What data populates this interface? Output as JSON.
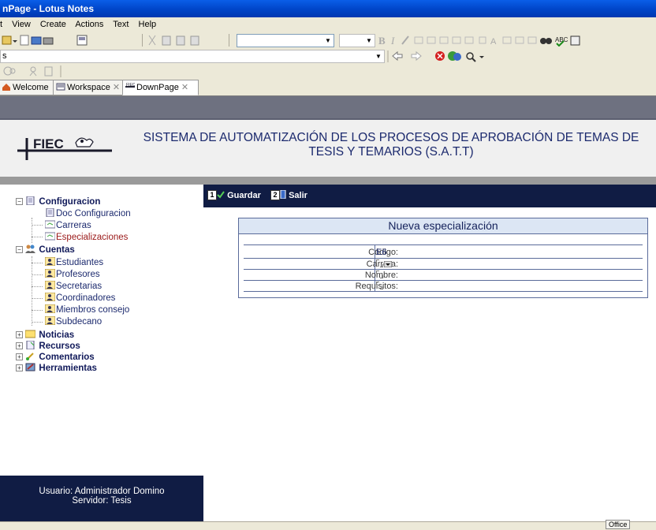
{
  "window": {
    "title": "nPage - Lotus Notes"
  },
  "menu": [
    "t",
    "View",
    "Create",
    "Actions",
    "Text",
    "Help"
  ],
  "toolbar": {
    "address_text": "s"
  },
  "tabs": [
    {
      "label": "Welcome",
      "icon": "home-icon"
    },
    {
      "label": "Workspace",
      "icon": "workspace-icon"
    },
    {
      "label": "DownPage",
      "icon": "fiec-icon"
    }
  ],
  "header": {
    "logo_text": "FIEC",
    "title_line1": "SISTEMA DE AUTOMATIZACIÓN DE LOS PROCESOS DE APROBACIÓN DE TEMAS DE",
    "title_line2": "TESIS Y TEMARIOS (S.A.T.T)"
  },
  "actions": {
    "guardar": {
      "num": "1",
      "label": "Guardar"
    },
    "salir": {
      "num": "2",
      "label": "Salir"
    }
  },
  "sidebar": {
    "configuracion": "Configuracion",
    "doc_configuracion": "Doc Configuracion",
    "carreras": "Carreras",
    "especializaciones": "Especializaciones",
    "cuentas": "Cuentas",
    "estudiantes": "Estudiantes",
    "profesores": "Profesores",
    "secretarias": "Secretarias",
    "coordinadores": "Coordinadores",
    "miembros_consejo": "Miembros consejo",
    "subdecano": "Subdecano",
    "noticias": "Noticias",
    "recursos": "Recursos",
    "comentarios": "Comentarios",
    "herramientas": "Herramientas"
  },
  "user_info": {
    "usuario": "Usuario: Administrador Domino",
    "servidor": "Servidor: Tesis"
  },
  "form": {
    "title": "Nueva especialización",
    "codigo_label": "Código:",
    "codigo_value": "E6",
    "carrera_label": "Carrera:",
    "nombre_label": "Nombre:",
    "requisitos_label": "Requisitos:"
  },
  "status": {
    "office": "Office"
  },
  "colors": {
    "title_bar": "#0a5ee8",
    "nav_dark": "#101c44",
    "header_text": "#1c2a6e",
    "form_header_bg": "#dce6f4"
  }
}
